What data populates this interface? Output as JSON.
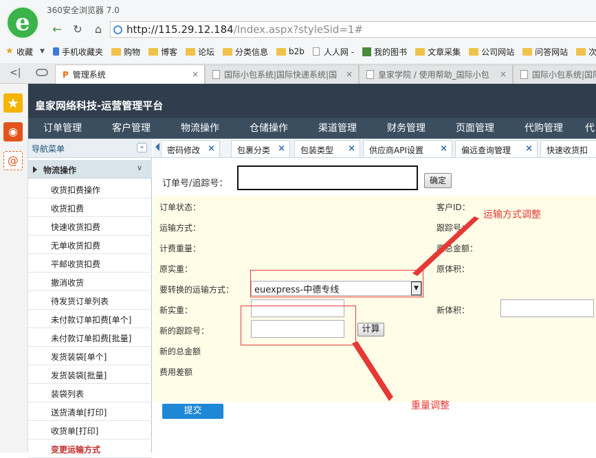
{
  "browser": {
    "app_title": "360安全浏览器 7.0",
    "url_host": "http://115.29.12.184",
    "url_path": "/Index.aspx?styleSid=1#",
    "logo_letter": "e",
    "bookmarks": [
      "收藏",
      "手机收藏夹",
      "购物",
      "博客",
      "论坛",
      "分类信息",
      "b2b",
      "人人网 -",
      "我的图书",
      "文章采集",
      "公司网站",
      "问答网站",
      "次要"
    ],
    "tabs": [
      {
        "label": "管理系统"
      },
      {
        "label": "国际小包系统|国际快递系统|国"
      },
      {
        "label": "皇家学院 / 使用帮助_国际小包"
      },
      {
        "label": "国际小包系统|国际"
      }
    ]
  },
  "app": {
    "title": "皇家网络科技-运营管理平台",
    "menu": [
      "订单管理",
      "客户管理",
      "物流操作",
      "仓储操作",
      "渠道管理",
      "财务管理",
      "页面管理",
      "代购管理",
      "代"
    ],
    "nav_title": "导航菜单",
    "group_title": "物流操作",
    "side_items": [
      "收货扣费操作",
      "收货扣费",
      "快速收货扣费",
      "无单收货扣费",
      "平邮收货扣费",
      "撤消收货",
      "待发货订单列表",
      "未付款订单扣费[单个]",
      "未付款订单扣费[批量]",
      "发货装袋[单个]",
      "发货装袋[批量]",
      "装袋列表",
      "送货清单[打印]",
      "收货单[打印]",
      "变更运输方式"
    ],
    "page_tabs": [
      "密码修改",
      "包裹分类",
      "包装类型",
      "供应商API设置",
      "偏远查询管理",
      "快速收货扣"
    ]
  },
  "form": {
    "search_label": "订单号/追踪号：",
    "search_value": "",
    "confirm_label": "确定",
    "order_status": "订单状态：",
    "customer_id": "客户ID：",
    "shipping_method": "运输方式：",
    "tracking_no": "跟踪号：",
    "billing_weight": "计费重量：",
    "original_total": "原总金额：",
    "actual_weight": "原实重：",
    "original_volume": "原体积：",
    "convert_method_label": "要转换的运输方式：",
    "convert_method_value": "euexpress-中德专线",
    "new_weight": "新实重：",
    "new_volume": "新体积：",
    "new_tracking": "新的跟踪号：",
    "calc_label": "计算",
    "new_total": "新的总金额",
    "fee_diff": "费用差额",
    "submit_label": "提交"
  },
  "annotations": {
    "shipping_adjust": "运输方式调整",
    "weight_adjust": "重量调整",
    "color": "#e53935"
  }
}
